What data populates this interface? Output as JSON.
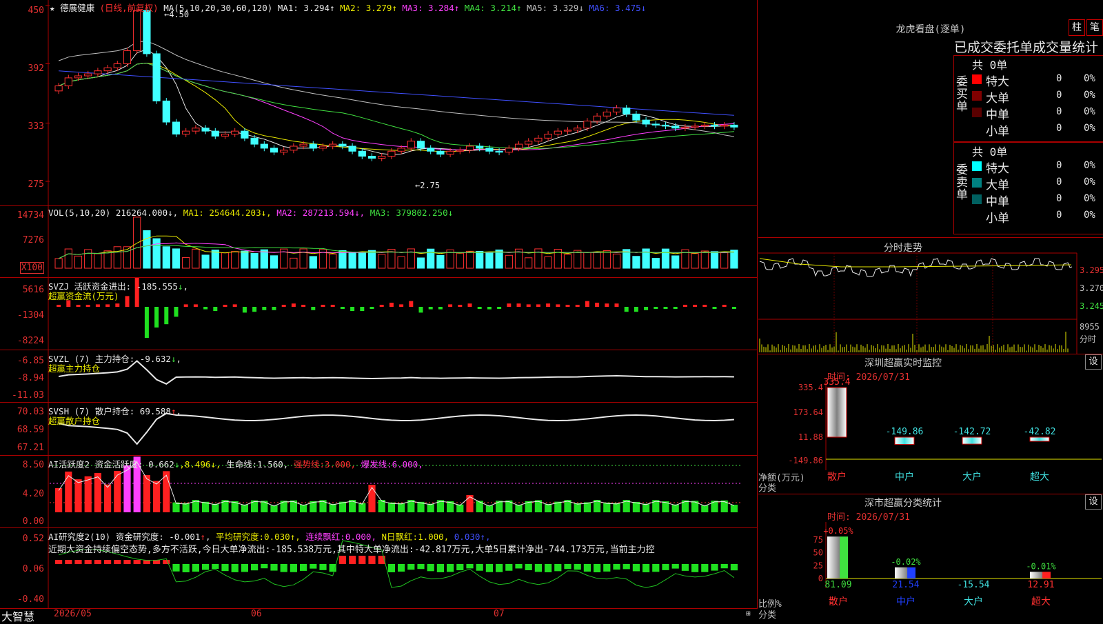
{
  "app": {
    "brand": "大智慧",
    "stock_name": "德展健康",
    "period_label": "(日线,前复权)"
  },
  "kline": {
    "ma_params": "MA(5,10,20,30,60,120)",
    "ma": [
      {
        "label": "MA1:",
        "value": "3.294",
        "arrow": "↑",
        "color": "#e8e8e8"
      },
      {
        "label": "MA2:",
        "value": "3.279",
        "arrow": "↑",
        "color": "#e8e800"
      },
      {
        "label": "MA3:",
        "value": "3.284",
        "arrow": "↑",
        "color": "#ff40ff"
      },
      {
        "label": "MA4:",
        "value": "3.214",
        "arrow": "↑",
        "color": "#40e040"
      },
      {
        "label": "MA5:",
        "value": "3.329",
        "arrow": "↓",
        "color": "#c0c0c0"
      },
      {
        "label": "MA6:",
        "value": "3.475",
        "arrow": "↓",
        "color": "#4050ff"
      }
    ],
    "yticks": [
      "450",
      "392",
      "333",
      "275"
    ],
    "high_label": "4.50",
    "low_label": "2.75"
  },
  "vol": {
    "header": "VOL(5,10,20)",
    "value": "216264.000",
    "ma1": "254644.203",
    "ma2": "287213.594",
    "ma3": "379802.250",
    "yticks": [
      "14734",
      "7276",
      "X100"
    ]
  },
  "svzj": {
    "header": "SVZJ  活跃资金进出:",
    "value": "-185.555",
    "arrow": "↓",
    "sub": "超赢资金流(万元)",
    "yticks": [
      "5616",
      "-1304",
      "-8224"
    ]
  },
  "svzl": {
    "header": "SVZL (7) 主力持仓:",
    "value": "-9.632",
    "arrow": "↓",
    "sub": "超赢主力持仓",
    "yticks": [
      "-6.85",
      "-8.94",
      "-11.03"
    ]
  },
  "svsh": {
    "header": "SVSH (7) 散户持仓:",
    "value": "69.588",
    "arrow": "↑",
    "sub": "超赢散户持仓",
    "yticks": [
      "70.03",
      "68.59",
      "67.21"
    ]
  },
  "ai1": {
    "header": "AI活跃度2 资金活跃度:",
    "value": "0.662",
    "arrow": "↓",
    "v2": "8.496",
    "life_label": "生命线:",
    "life": "1.560",
    "strong_label": "强势线:",
    "strong": "3.000",
    "burst_label": "爆发线:",
    "burst": "6.000",
    "yticks": [
      "8.50",
      "4.20",
      "0.00"
    ]
  },
  "ai2": {
    "header": "AI研究度2(10) 资金研究度:",
    "value": "-0.001",
    "arrow": "↑",
    "avg_label": "平均研究度:",
    "avg": "0.030",
    "red_label": "连续飘红:",
    "red": "0.000",
    "nred_label": "N日飘红:",
    "nred": "1.000",
    "extra": "0.030",
    "summary": "近期大资金持续偏空态势,多方不活跃,今日大单净流出:-185.538万元,其中特大单净流出:-42.817万元,大单5日累计净出-744.173万元,当前主力控",
    "yticks": [
      "0.52",
      "0.06",
      "-0.40"
    ]
  },
  "xaxis": {
    "labels": [
      "2026/05",
      "06",
      "07"
    ]
  },
  "dragon": {
    "title": "龙虎看盘(逐单)",
    "btn1": "柱",
    "btn2": "笔",
    "subtitle": "已成交委托单成交量统计",
    "buy": {
      "side_label": "委买单",
      "total": "共 0单",
      "rows": [
        {
          "name": "特大",
          "count": "0",
          "pct": "0%",
          "color": "#ff0000"
        },
        {
          "name": "大单",
          "count": "0",
          "pct": "0%",
          "color": "#800000"
        },
        {
          "name": "中单",
          "count": "0",
          "pct": "0%",
          "color": "#5a0000"
        },
        {
          "name": "小单",
          "count": "0",
          "pct": "0%",
          "color": "#000000"
        }
      ]
    },
    "sell": {
      "side_label": "委卖单",
      "total": "共 0单",
      "rows": [
        {
          "name": "特大",
          "count": "0",
          "pct": "0%",
          "color": "#00ffff"
        },
        {
          "name": "大单",
          "count": "0",
          "pct": "0%",
          "color": "#008080"
        },
        {
          "name": "中单",
          "count": "0",
          "pct": "0%",
          "color": "#006060"
        },
        {
          "name": "小单",
          "count": "0",
          "pct": "0%",
          "color": "#000000"
        }
      ]
    }
  },
  "intraday": {
    "title": "分时走势",
    "yticks": [
      "3.295",
      "3.270",
      "3.245"
    ],
    "vol_max": "8955",
    "vol_label": "分时"
  },
  "monitor": {
    "title": "深圳超赢实时监控",
    "gear": "设",
    "time": "时间: 2026/07/31",
    "yticks": [
      "335.4",
      "173.64",
      "11.88",
      "-149.86"
    ],
    "ylabel1": "净额(万元)",
    "ylabel2": "分类",
    "bars": [
      {
        "cat": "散户",
        "value": "335.4",
        "num": 335.4
      },
      {
        "cat": "中户",
        "value": "-149.86",
        "num": -149.86
      },
      {
        "cat": "大户",
        "value": "-142.72",
        "num": -142.72
      },
      {
        "cat": "超大",
        "value": "-42.82",
        "num": -42.82
      }
    ]
  },
  "classify": {
    "title": "深市超赢分类统计",
    "gear": "设",
    "time": "时间: 2026/07/31",
    "yticks": [
      "75",
      "50",
      "25",
      "0"
    ],
    "ylabel1": "比例%",
    "ylabel2": "分类",
    "bars": [
      {
        "cat": "散户",
        "value": "81.09",
        "top": "+0.05%",
        "num": 81.09,
        "color": "#40e040"
      },
      {
        "cat": "中户",
        "value": "21.54",
        "top": "-0.02%",
        "num": 21.54,
        "color": "#2040ff"
      },
      {
        "cat": "大户",
        "value": "-15.54",
        "top": "",
        "num": 0,
        "color": "#00ffff"
      },
      {
        "cat": "超大",
        "value": "12.91",
        "top": "-0.01%",
        "num": 12.91,
        "color": "#ff2020"
      }
    ]
  },
  "chart_data": {
    "type": "candlestick",
    "x": [
      "2026/05",
      "",
      "",
      "",
      "",
      "",
      "",
      "",
      "",
      "",
      "",
      "",
      "",
      "",
      "",
      "",
      "",
      "",
      "",
      "",
      "",
      "06",
      "",
      "",
      "",
      "",
      "",
      "",
      "",
      "",
      "",
      "",
      "",
      "",
      "",
      "",
      "",
      "",
      "",
      "",
      "",
      "",
      "",
      "",
      "",
      "",
      "",
      "",
      "",
      "",
      "",
      "",
      "",
      "",
      "",
      "",
      "",
      "07",
      "",
      "",
      "",
      "",
      "",
      "",
      "",
      "",
      "",
      "",
      "",
      "",
      "",
      "",
      "",
      "",
      "",
      "",
      "",
      "",
      ""
    ],
    "close": [
      3.7,
      3.78,
      3.8,
      3.82,
      3.85,
      3.88,
      3.92,
      4.05,
      4.45,
      4.02,
      3.55,
      3.34,
      3.22,
      3.25,
      3.28,
      3.25,
      3.2,
      3.22,
      3.25,
      3.18,
      3.12,
      3.08,
      3.04,
      3.06,
      3.1,
      3.12,
      3.08,
      3.1,
      3.12,
      3.1,
      3.05,
      3.0,
      2.98,
      3.0,
      3.05,
      3.08,
      3.15,
      3.08,
      3.05,
      3.02,
      3.05,
      3.06,
      3.1,
      3.08,
      3.05,
      3.04,
      3.08,
      3.12,
      3.15,
      3.18,
      3.22,
      3.25,
      3.26,
      3.28,
      3.35,
      3.4,
      3.44,
      3.48,
      3.42,
      3.36,
      3.32,
      3.31,
      3.3,
      3.28,
      3.29,
      3.3,
      3.31,
      3.3,
      3.31,
      3.29
    ],
    "ylim": [
      2.75,
      4.5
    ],
    "high": 4.5,
    "low": 2.75
  }
}
